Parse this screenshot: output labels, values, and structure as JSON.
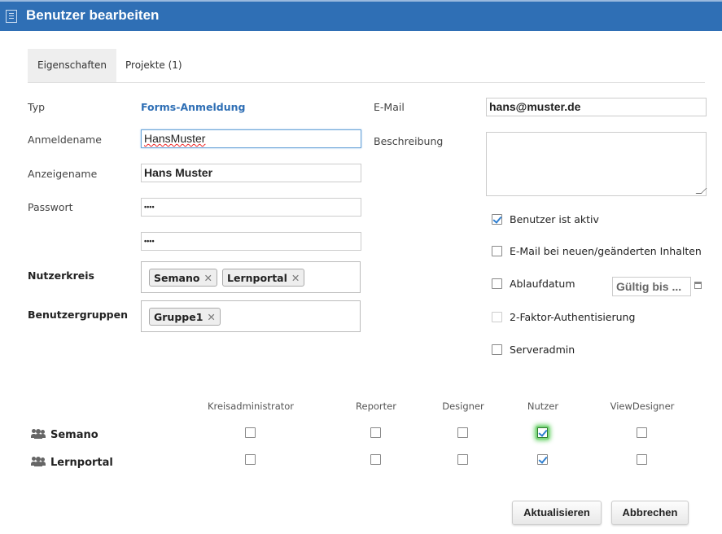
{
  "window": {
    "title": "Benutzer bearbeiten"
  },
  "tabs": [
    {
      "label": "Eigenschaften",
      "active": true
    },
    {
      "label": "Projekte (1)",
      "active": false
    }
  ],
  "form": {
    "typ_label": "Typ",
    "typ_value": "Forms-Anmeldung",
    "anmeldename_label": "Anmeldename",
    "anmeldename_value": "HansMuster",
    "anzeigename_label": "Anzeigename",
    "anzeigename_value": "Hans Muster",
    "passwort_label": "Passwort",
    "passwort_value": "••••",
    "passwort_confirm_value": "••••",
    "nutzerkreis_label": "Nutzerkreis",
    "nutzerkreis_chips": [
      "Semano",
      "Lernportal"
    ],
    "benutzergruppen_label": "Benutzergruppen",
    "benutzergruppen_chips": [
      "Gruppe1"
    ],
    "email_label": "E-Mail",
    "email_value": "hans@muster.de",
    "beschreibung_label": "Beschreibung",
    "beschreibung_value": ""
  },
  "options": {
    "aktiv_label": "Benutzer ist aktiv",
    "aktiv_checked": true,
    "email_notify_label": "E-Mail bei neuen/geänderten Inhalten",
    "email_notify_checked": false,
    "ablaufdatum_label": "Ablaufdatum",
    "ablaufdatum_checked": false,
    "ablaufdatum_placeholder": "Gültig bis ...",
    "twofa_label": "2-Faktor-Authentisierung",
    "twofa_checked": false,
    "serveradmin_label": "Serveradmin",
    "serveradmin_checked": false
  },
  "roles": {
    "columns": [
      "Kreisadministrator",
      "Reporter",
      "Designer",
      "Nutzer",
      "ViewDesigner"
    ],
    "rows": [
      {
        "name": "Semano",
        "values": [
          false,
          false,
          false,
          true,
          false
        ]
      },
      {
        "name": "Lernportal",
        "values": [
          false,
          false,
          false,
          true,
          false
        ]
      }
    ],
    "icon": "users-icon"
  },
  "buttons": {
    "update_label": "Aktualisieren",
    "cancel_label": "Abbrechen"
  },
  "colors": {
    "titlebar": "#2f6fb5",
    "link": "#2f6fb5",
    "check": "#2f7fd0",
    "highlight": "#5fd05f"
  }
}
